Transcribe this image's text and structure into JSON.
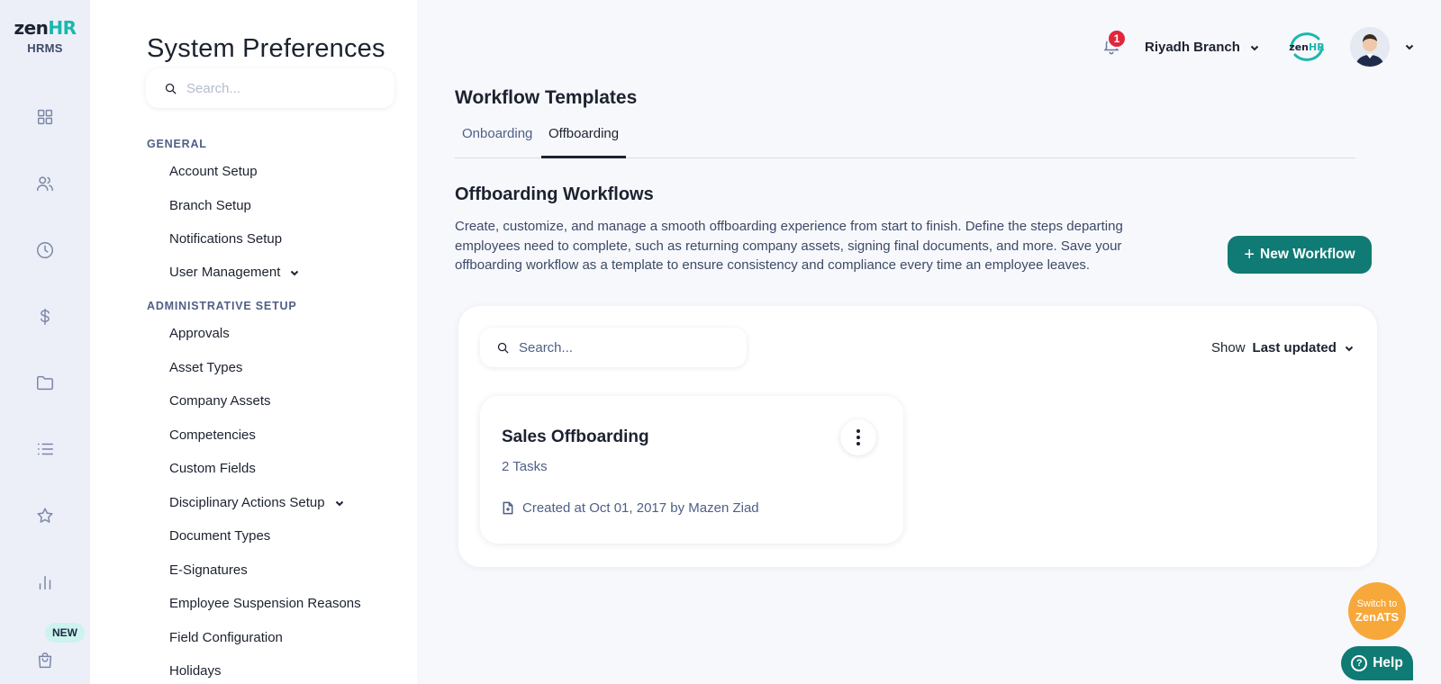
{
  "brand": {
    "logo_main": "zen",
    "logo_accent": "HR",
    "subtitle": "HRMS"
  },
  "rail": {
    "icons": [
      "dashboard-icon",
      "users-icon",
      "clock-icon",
      "dollar-icon",
      "folder-icon",
      "list-icon",
      "star-icon",
      "bar-chart-icon",
      "shopping-bag-icon"
    ],
    "new_badge": "NEW"
  },
  "sidebar": {
    "title": "System Preferences",
    "search_placeholder": "Search...",
    "sections": [
      {
        "heading": "GENERAL",
        "items": [
          "Account Setup",
          "Branch Setup",
          "Notifications Setup",
          "User Management"
        ]
      },
      {
        "heading": "ADMINISTRATIVE SETUP",
        "items": [
          "Approvals",
          "Asset Types",
          "Company Assets",
          "Competencies",
          "Custom Fields",
          "Disciplinary Actions Setup",
          "Document Types",
          "E-Signatures",
          "Employee Suspension Reasons",
          "Field Configuration",
          "Holidays"
        ]
      }
    ]
  },
  "header": {
    "notification_count": "1",
    "branch": "Riyadh Branch",
    "mini_logo": "zenHR"
  },
  "main": {
    "title": "Workflow Templates",
    "tabs": [
      {
        "label": "Onboarding",
        "active": false
      },
      {
        "label": "Offboarding",
        "active": true
      }
    ],
    "section_title": "Offboarding Workflows",
    "section_desc": "Create, customize, and manage a smooth offboarding experience from start to finish. Define the steps departing employees need to complete, such as returning company assets, signing final documents, and more. Save your offboarding workflow as a template to ensure consistency and compliance every time an employee leaves.",
    "new_button": "New Workflow",
    "panel": {
      "search_placeholder": "Search...",
      "sort_label": "Show",
      "sort_value": "Last updated"
    },
    "cards": [
      {
        "title": "Sales Offboarding",
        "tasks": "2 Tasks",
        "created": "Created at Oct 01, 2017 by Mazen Ziad"
      }
    ]
  },
  "floating": {
    "zenats_line1": "Switch to",
    "zenats_line2": "ZenATS",
    "help": "Help"
  },
  "colors": {
    "accent": "#107a74",
    "brand_teal": "#19b8ad",
    "badge_red": "#e0283c",
    "zenats_orange": "#f7a83a"
  }
}
